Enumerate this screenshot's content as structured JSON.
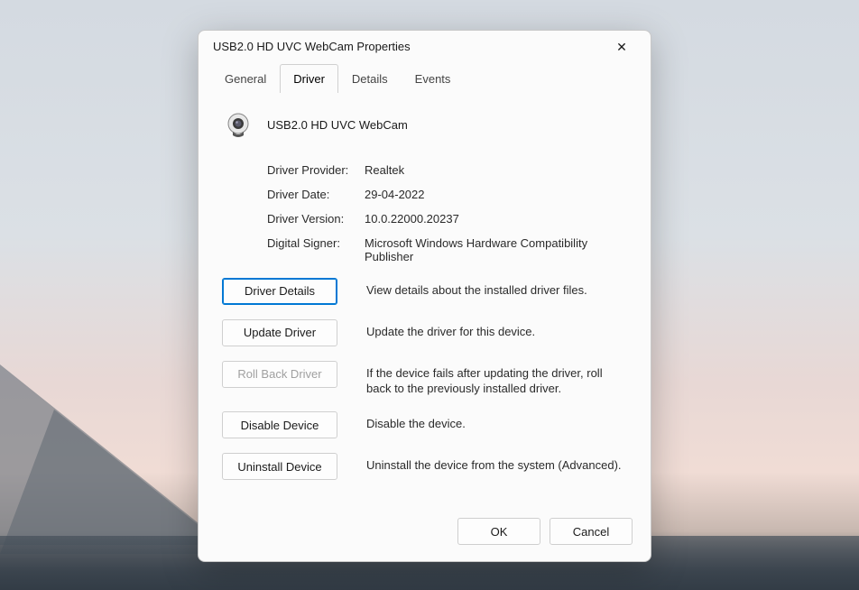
{
  "window": {
    "title": "USB2.0 HD UVC WebCam Properties"
  },
  "tabs": [
    {
      "label": "General"
    },
    {
      "label": "Driver"
    },
    {
      "label": "Details"
    },
    {
      "label": "Events"
    }
  ],
  "device": {
    "name": "USB2.0 HD UVC WebCam"
  },
  "info": {
    "provider_label": "Driver Provider:",
    "provider_value": "Realtek",
    "date_label": "Driver Date:",
    "date_value": "29-04-2022",
    "version_label": "Driver Version:",
    "version_value": "10.0.22000.20237",
    "signer_label": "Digital Signer:",
    "signer_value": "Microsoft Windows Hardware Compatibility Publisher"
  },
  "actions": {
    "details_btn": "Driver Details",
    "details_desc": "View details about the installed driver files.",
    "update_btn": "Update Driver",
    "update_desc": "Update the driver for this device.",
    "rollback_btn": "Roll Back Driver",
    "rollback_desc": "If the device fails after updating the driver, roll back to the previously installed driver.",
    "disable_btn": "Disable Device",
    "disable_desc": "Disable the device.",
    "uninstall_btn": "Uninstall Device",
    "uninstall_desc": "Uninstall the device from the system (Advanced)."
  },
  "footer": {
    "ok": "OK",
    "cancel": "Cancel"
  }
}
